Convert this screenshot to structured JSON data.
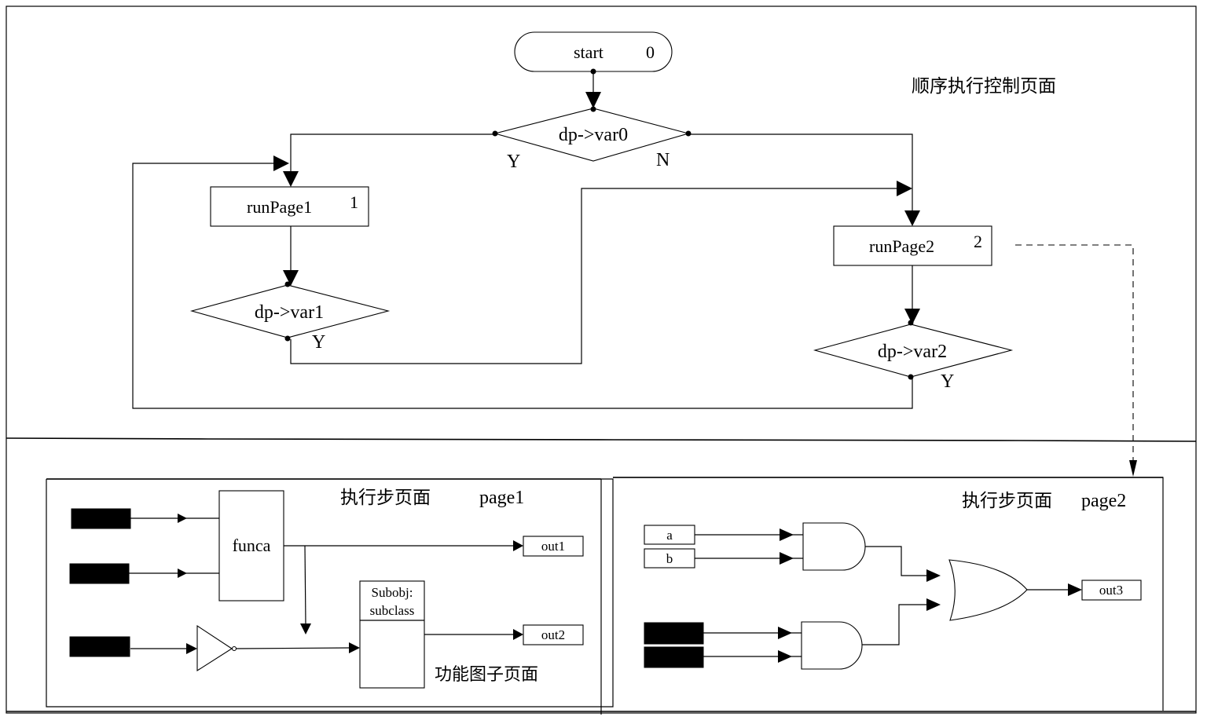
{
  "flow": {
    "title": "顺序执行控制页面",
    "start": {
      "label": "start",
      "index": "0"
    },
    "decision0": {
      "label": "dp->var0",
      "yes": "Y",
      "no": "N"
    },
    "step1": {
      "label": "runPage1",
      "index": "1"
    },
    "decision1": {
      "label": "dp->var1",
      "yes": "Y"
    },
    "step2": {
      "label": "runPage2",
      "index": "2"
    },
    "decision2": {
      "label": "dp->var2",
      "yes": "Y"
    }
  },
  "page1": {
    "title": "执行步页面",
    "name": "page1",
    "func_block": "funca",
    "subobj_line1": "Subobj:",
    "subobj_line2": "subclass",
    "sub_caption": "功能图子页面",
    "outputs": [
      "out1",
      "out2"
    ]
  },
  "page2": {
    "title": "执行步页面",
    "name": "page2",
    "inputs": [
      "a",
      "b"
    ],
    "output": "out3"
  }
}
